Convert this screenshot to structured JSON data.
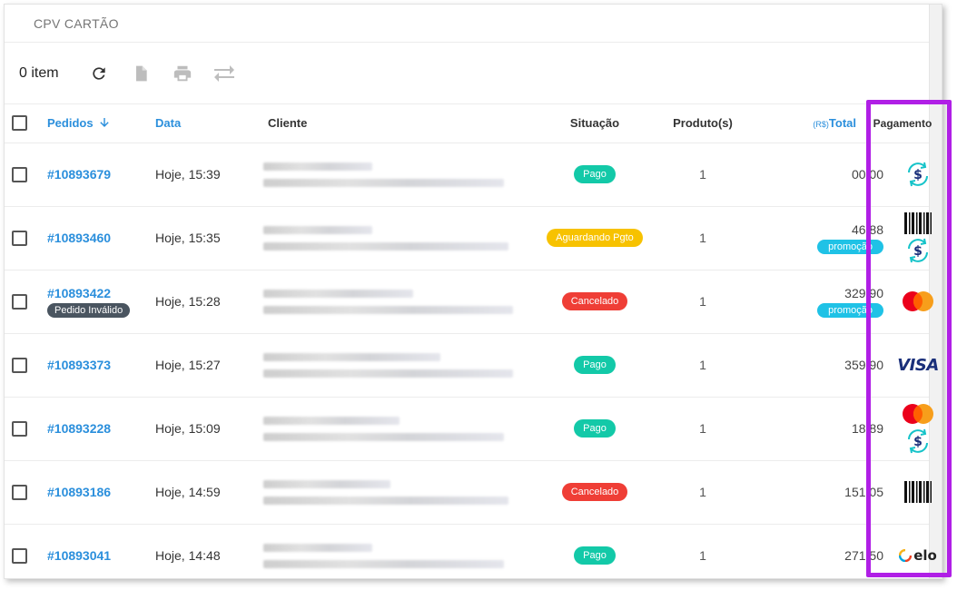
{
  "header": {
    "title": "CPV CARTÃO"
  },
  "toolbar": {
    "item_count": "0 item",
    "buttons": [
      "refresh-icon",
      "document-icon",
      "print-icon",
      "transfer-icon"
    ]
  },
  "table": {
    "columns": {
      "pedidos": "Pedidos",
      "data": "Data",
      "cliente": "Cliente",
      "situacao": "Situação",
      "produtos": "Produto(s)",
      "total_currency": "(R$)",
      "total": "Total",
      "pagamento": "Pagamento"
    },
    "rows": [
      {
        "order": "#10893679",
        "badge": "",
        "date": "Hoje, 15:39",
        "status": "Pago",
        "status_type": "pago",
        "qty": "1",
        "total": "00,00",
        "promo": "",
        "payments": [
          "pix-icon"
        ]
      },
      {
        "order": "#10893460",
        "badge": "",
        "date": "Hoje, 15:35",
        "status": "Aguardando Pgto",
        "status_type": "aguardando",
        "qty": "1",
        "total": "46,88",
        "promo": "promoção",
        "payments": [
          "barcode-icon",
          "pix-icon"
        ]
      },
      {
        "order": "#10893422",
        "badge": "Pedido Inválido",
        "date": "Hoje, 15:28",
        "status": "Cancelado",
        "status_type": "cancelado",
        "qty": "1",
        "total": "329,90",
        "promo": "promoção",
        "payments": [
          "mastercard-icon"
        ]
      },
      {
        "order": "#10893373",
        "badge": "",
        "date": "Hoje, 15:27",
        "status": "Pago",
        "status_type": "pago",
        "qty": "1",
        "total": "359,90",
        "promo": "",
        "payments": [
          "visa-icon"
        ]
      },
      {
        "order": "#10893228",
        "badge": "",
        "date": "Hoje, 15:09",
        "status": "Pago",
        "status_type": "pago",
        "qty": "1",
        "total": "18,89",
        "promo": "",
        "payments": [
          "mastercard-icon",
          "pix-icon"
        ]
      },
      {
        "order": "#10893186",
        "badge": "",
        "date": "Hoje, 14:59",
        "status": "Cancelado",
        "status_type": "cancelado",
        "qty": "1",
        "total": "151,05",
        "promo": "",
        "payments": [
          "barcode-icon"
        ]
      },
      {
        "order": "#10893041",
        "badge": "",
        "date": "Hoje, 14:48",
        "status": "Pago",
        "status_type": "pago",
        "qty": "1",
        "total": "271,50",
        "promo": "",
        "payments": [
          "elo-icon"
        ]
      }
    ]
  },
  "brand_text": {
    "visa": "VISA",
    "elo": "elo"
  },
  "colors": {
    "link": "#2b8fdc",
    "pago": "#13c9a8",
    "aguardando": "#f7c200",
    "cancelado": "#ef3e36",
    "promo": "#1fc2e6",
    "highlight": "#b01fe6"
  }
}
